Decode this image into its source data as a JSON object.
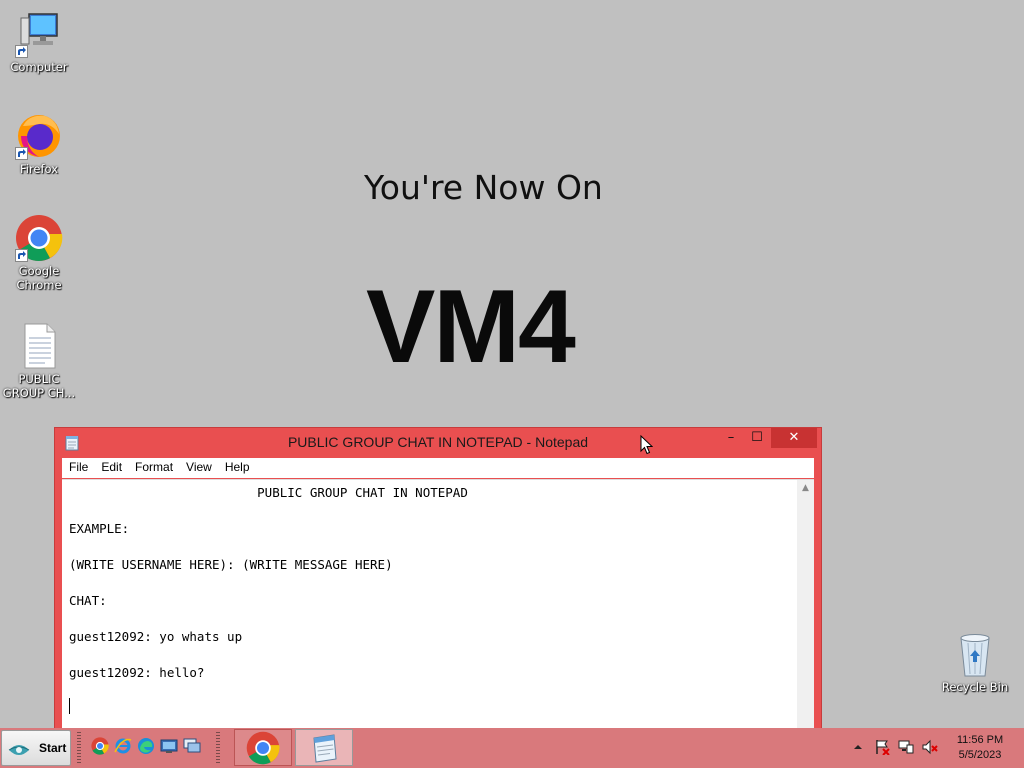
{
  "desktop": {
    "icons": [
      {
        "label": "Computer",
        "icon": "computer-icon"
      },
      {
        "label": "Firefox",
        "icon": "firefox-icon"
      },
      {
        "label": "Google\nChrome",
        "icon": "chrome-icon"
      },
      {
        "label": "PUBLIC\nGROUP CH...",
        "icon": "text-file-icon"
      }
    ],
    "recycle_bin": {
      "label": "Recycle Bin",
      "icon": "recycle-bin-icon"
    },
    "wallpaper": {
      "subtitle": "You're Now On",
      "headline": "VM4"
    }
  },
  "notepad": {
    "title": "PUBLIC GROUP CHAT IN NOTEPAD - Notepad",
    "buttons": {
      "minimize": "–",
      "maximize": "☐",
      "close": "✕"
    },
    "menu": [
      "File",
      "Edit",
      "Format",
      "View",
      "Help"
    ],
    "content": "                         PUBLIC GROUP CHAT IN NOTEPAD\n\nEXAMPLE:\n\n(WRITE USERNAME HERE): (WRITE MESSAGE HERE)\n\nCHAT:\n\nguest12092: yo whats up\n\nguest12092: hello?\n"
  },
  "taskbar": {
    "start_label": "Start",
    "quick_launch": [
      "chrome-icon",
      "internet-explorer-icon",
      "edge-icon",
      "show-desktop-icon",
      "switch-windows-icon"
    ],
    "tasks": [
      "chrome-task",
      "notepad-task"
    ],
    "tray": [
      "show-hidden-icons",
      "action-center-flag-icon",
      "network-icon",
      "volume-muted-icon"
    ],
    "time": "11:56 PM",
    "date": "5/5/2023"
  },
  "colors": {
    "desktop_bg": "#c0c0c0",
    "window_frame": "#e94f50",
    "close_button": "#c83232",
    "taskbar": "#d9797c"
  }
}
